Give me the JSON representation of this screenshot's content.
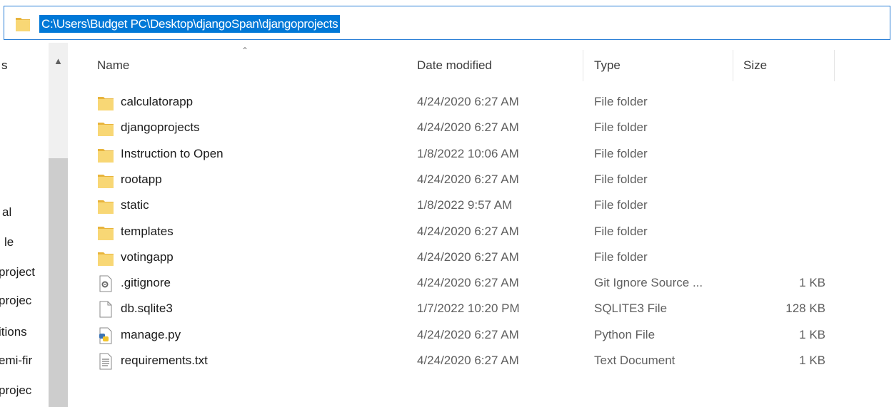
{
  "address_bar": {
    "path": "C:\\Users\\Budget PC\\Desktop\\djangoSpan\\djangoprojects"
  },
  "nav_pane": {
    "items": [
      "s",
      "al",
      "le",
      "project",
      "projec",
      "itions",
      "emi-fir",
      "projec"
    ]
  },
  "columns": {
    "name": "Name",
    "date": "Date modified",
    "type": "Type",
    "size": "Size"
  },
  "files": [
    {
      "name": "calculatorapp",
      "date": "4/24/2020 6:27 AM",
      "type": "File folder",
      "size": "",
      "icon": "folder-icon"
    },
    {
      "name": "djangoprojects",
      "date": "4/24/2020 6:27 AM",
      "type": "File folder",
      "size": "",
      "icon": "folder-icon"
    },
    {
      "name": "Instruction to Open",
      "date": "1/8/2022 10:06 AM",
      "type": "File folder",
      "size": "",
      "icon": "folder-icon"
    },
    {
      "name": "rootapp",
      "date": "4/24/2020 6:27 AM",
      "type": "File folder",
      "size": "",
      "icon": "folder-icon"
    },
    {
      "name": "static",
      "date": "1/8/2022 9:57 AM",
      "type": "File folder",
      "size": "",
      "icon": "folder-icon"
    },
    {
      "name": "templates",
      "date": "4/24/2020 6:27 AM",
      "type": "File folder",
      "size": "",
      "icon": "folder-icon"
    },
    {
      "name": "votingapp",
      "date": "4/24/2020 6:27 AM",
      "type": "File folder",
      "size": "",
      "icon": "folder-icon"
    },
    {
      "name": ".gitignore",
      "date": "4/24/2020 6:27 AM",
      "type": "Git Ignore Source ...",
      "size": "1 KB",
      "icon": "settings-file-icon"
    },
    {
      "name": "db.sqlite3",
      "date": "1/7/2022 10:20 PM",
      "type": "SQLITE3 File",
      "size": "128 KB",
      "icon": "blank-file-icon"
    },
    {
      "name": "manage.py",
      "date": "4/24/2020 6:27 AM",
      "type": "Python File",
      "size": "1 KB",
      "icon": "python-file-icon"
    },
    {
      "name": "requirements.txt",
      "date": "4/24/2020 6:27 AM",
      "type": "Text Document",
      "size": "1 KB",
      "icon": "text-file-icon"
    }
  ],
  "colors": {
    "selection": "#0078d7",
    "folder": "#f8d775",
    "folder_dark": "#e8b43c",
    "scrollbar_track": "#f0f0f0",
    "scrollbar_thumb": "#cdcdcd"
  }
}
